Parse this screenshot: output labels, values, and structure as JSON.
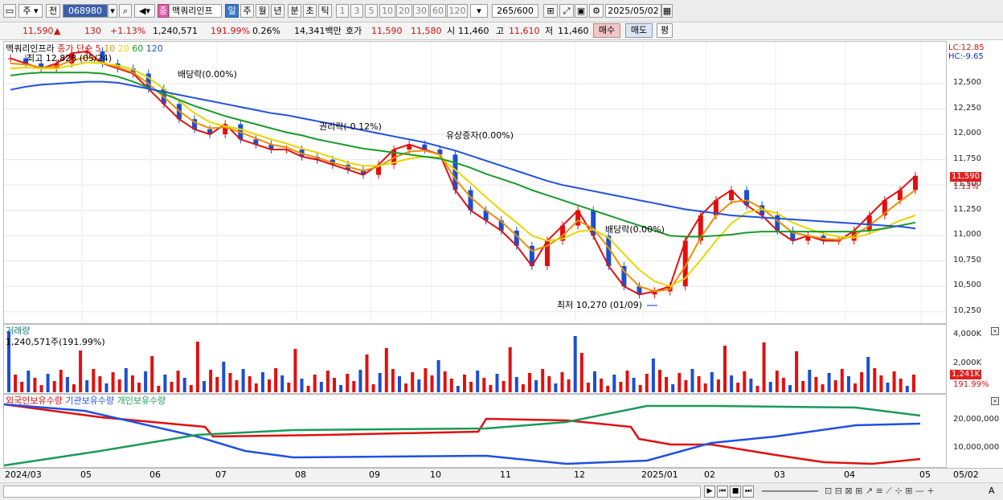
{
  "toolbar": {
    "type_select": "주",
    "prev_label": "전",
    "code": "068980",
    "name": "맥쿼리인프",
    "periods": [
      "일",
      "주",
      "월",
      "년",
      "분",
      "초",
      "틱"
    ],
    "minutes": [
      "1",
      "3",
      "5",
      "10",
      "20",
      "30",
      "60",
      "120"
    ],
    "count": "265",
    "max_count": "/600",
    "date": "2025/05/02"
  },
  "quote": {
    "price": "11,590",
    "arrow": "▲",
    "change": "130",
    "change_pct": "+1.13%",
    "volume": "1,240,571",
    "vol_ratio": "191.99%",
    "turnover_rate": "0.26%",
    "amount": "14,341백만",
    "hoga_label": "호가",
    "ask": "11,590",
    "bid": "11,580",
    "open_label": "시",
    "open": "11,460",
    "high_label": "고",
    "high": "11,610",
    "low_label": "저",
    "low": "11,460",
    "buy_label": "매수",
    "sell_label": "매도",
    "eval_label": "평"
  },
  "price_panel": {
    "legend_name": "맥쿼리인프라",
    "legend_type": "종가 단순",
    "ma": [
      {
        "period": "5",
        "color": "#e01010"
      },
      {
        "period": "10",
        "color": "#f08c00"
      },
      {
        "period": "20",
        "color": "#e6d600"
      },
      {
        "period": "60",
        "color": "#1a9a2a"
      },
      {
        "period": "120",
        "color": "#2050e0"
      }
    ],
    "max_note": "최고 12,828 (05/24)",
    "min_note": "최저 10,270 (01/09)",
    "events": [
      "배당락(0.00%)",
      "권리락(-0.12%)",
      "유상증자(0.00%)",
      "배당락(0.00%)"
    ],
    "lc": "LC:12.85",
    "hc": "HC:-9.65",
    "yticks": [
      "12,500",
      "12,250",
      "12,000",
      "11,750",
      "11,500",
      "11,250",
      "11,000",
      "10,750",
      "10,500",
      "10,250"
    ],
    "last_price": "11,590",
    "last_pct": "1.13%"
  },
  "volume_panel": {
    "title": "거래량",
    "value": "1,240,571주(191.99%)",
    "yticks": [
      "4,000K",
      "2,000K"
    ],
    "last": "1,241K",
    "last_pct": "191.99%"
  },
  "holding_panel": {
    "legend": [
      {
        "name": "외국인보유수량",
        "color": "#e01010"
      },
      {
        "name": "기관보유수량",
        "color": "#2050e0"
      },
      {
        "name": "개인보유수량",
        "color": "#1a9a5a"
      }
    ],
    "yticks": [
      "20,000,000",
      "10,000,000"
    ]
  },
  "xaxis": [
    "2024/03",
    "05",
    "06",
    "07",
    "08",
    "09",
    "10",
    "11",
    "12",
    "2025/01",
    "02",
    "03",
    "04",
    "05",
    "05/02"
  ],
  "colors": {
    "up": "#e01010",
    "down": "#1a4fd0",
    "accent": "#3a78c8"
  },
  "chart_data": {
    "type": "line",
    "title": "",
    "price_ylim": [
      10200,
      12850
    ],
    "series": [
      {
        "name": "5",
        "values": [
          12750,
          12700,
          12650,
          12700,
          12800,
          12820,
          12700,
          12650,
          12600,
          12450,
          12300,
          12150,
          12050,
          12000,
          12100,
          11950,
          11900,
          11850,
          11850,
          11780,
          11750,
          11700,
          11650,
          11600,
          11700,
          11850,
          11900,
          11850,
          11800,
          11450,
          11250,
          11150,
          11050,
          10900,
          10700,
          10950,
          11100,
          11250,
          11000,
          10700,
          10500,
          10420,
          10450,
          10500,
          10950,
          11200,
          11350,
          11450,
          11300,
          11200,
          11050,
          10950,
          11000,
          10950,
          10950,
          11050,
          11200,
          11350,
          11450,
          11590
        ]
      },
      {
        "name": "10",
        "values": [
          12700,
          12690,
          12660,
          12670,
          12730,
          12760,
          12710,
          12660,
          12610,
          12500,
          12370,
          12230,
          12120,
          12060,
          12070,
          12020,
          11960,
          11900,
          11870,
          11810,
          11770,
          11720,
          11680,
          11640,
          11680,
          11770,
          11830,
          11840,
          11800,
          11560,
          11380,
          11250,
          11140,
          11000,
          10850,
          10900,
          11000,
          11150,
          11070,
          10880,
          10650,
          10500,
          10450,
          10470,
          10700,
          10980,
          11200,
          11330,
          11350,
          11270,
          11150,
          11030,
          11000,
          10970,
          10960,
          11000,
          11100,
          11220,
          11340,
          11450
        ]
      },
      {
        "name": "20",
        "values": [
          12650,
          12660,
          12650,
          12650,
          12680,
          12710,
          12700,
          12680,
          12640,
          12560,
          12450,
          12330,
          12210,
          12120,
          12080,
          12050,
          12000,
          11950,
          11910,
          11860,
          11820,
          11770,
          11720,
          11690,
          11690,
          11720,
          11760,
          11780,
          11770,
          11650,
          11520,
          11380,
          11250,
          11130,
          11000,
          10950,
          10970,
          11040,
          11060,
          10980,
          10820,
          10660,
          10550,
          10500,
          10580,
          10760,
          10950,
          11120,
          11230,
          11260,
          11220,
          11130,
          11070,
          11020,
          10990,
          10980,
          11020,
          11080,
          11150,
          11200
        ]
      },
      {
        "name": "60",
        "values": [
          12580,
          12600,
          12610,
          12610,
          12610,
          12610,
          12600,
          12570,
          12520,
          12460,
          12400,
          12340,
          12280,
          12230,
          12180,
          12140,
          12100,
          12060,
          12020,
          11990,
          11950,
          11920,
          11890,
          11860,
          11840,
          11820,
          11800,
          11780,
          11760,
          11720,
          11670,
          11610,
          11560,
          11510,
          11450,
          11400,
          11350,
          11300,
          11250,
          11200,
          11150,
          11100,
          11050,
          11000,
          10990,
          10990,
          11000,
          11010,
          11030,
          11040,
          11040,
          11040,
          11040,
          11040,
          11040,
          11040,
          11050,
          11070,
          11100,
          11130
        ]
      },
      {
        "name": "120",
        "values": [
          12440,
          12470,
          12490,
          12500,
          12510,
          12520,
          12520,
          12510,
          12480,
          12450,
          12420,
          12390,
          12360,
          12330,
          12300,
          12270,
          12240,
          12210,
          12190,
          12160,
          12130,
          12100,
          12070,
          12040,
          12010,
          11980,
          11950,
          11920,
          11880,
          11840,
          11790,
          11740,
          11690,
          11640,
          11590,
          11540,
          11500,
          11470,
          11440,
          11410,
          11380,
          11350,
          11320,
          11290,
          11260,
          11240,
          11220,
          11200,
          11190,
          11180,
          11170,
          11160,
          11150,
          11140,
          11130,
          11120,
          11110,
          11100,
          11090,
          11070
        ]
      }
    ]
  }
}
